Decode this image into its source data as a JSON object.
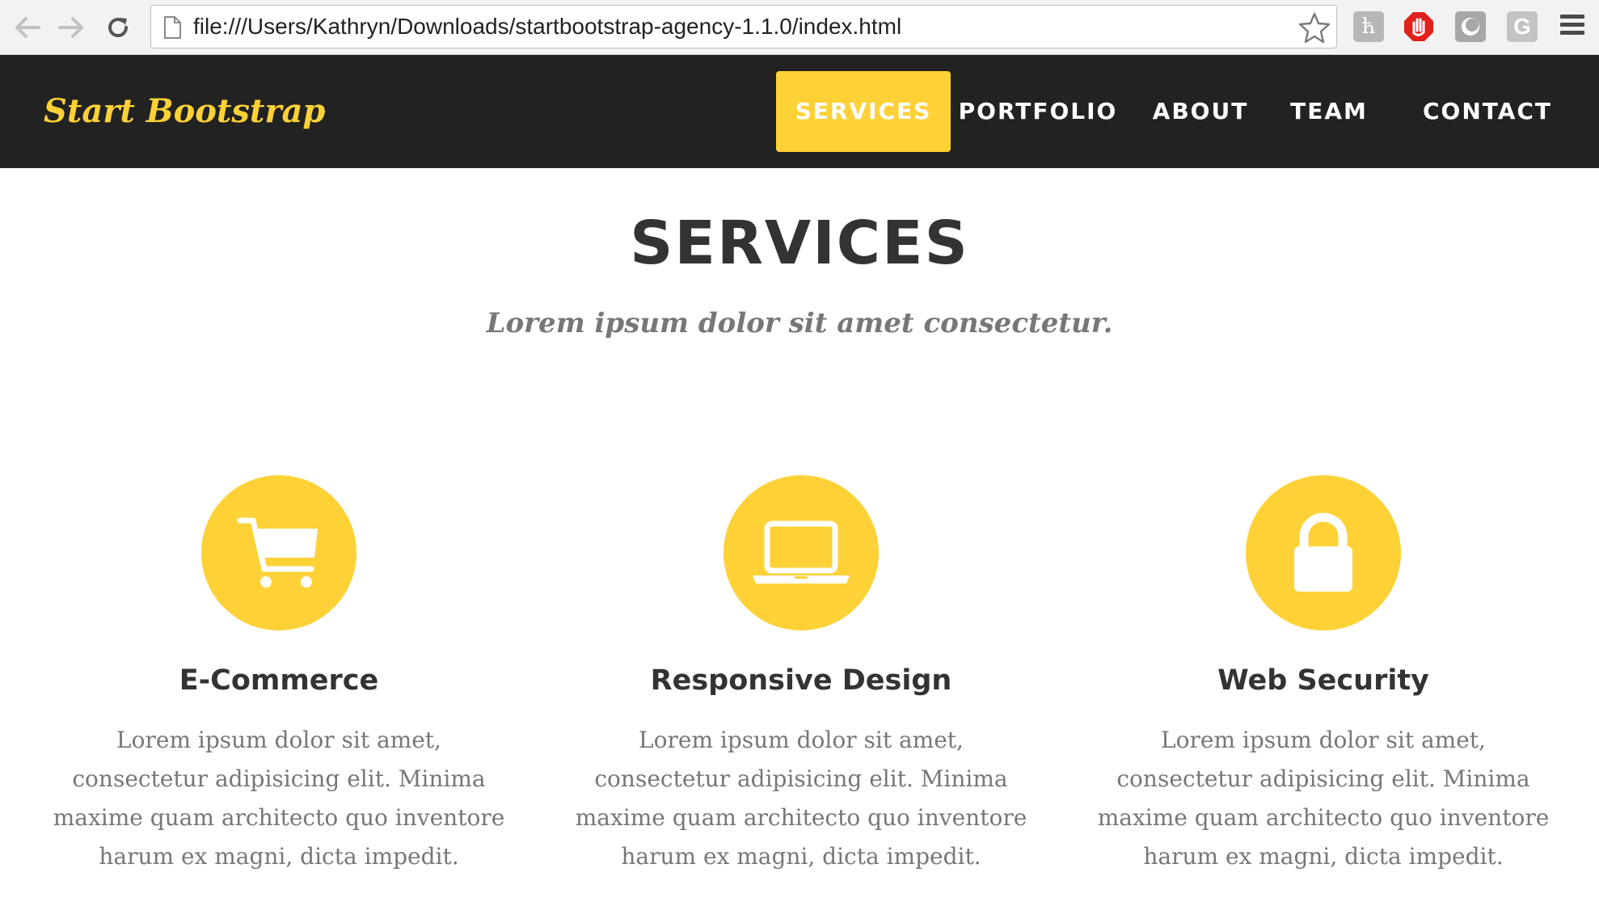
{
  "browser": {
    "url": "file:///Users/Kathryn/Downloads/startbootstrap-agency-1.1.0/index.html",
    "extensions": [
      "hootsuite-icon",
      "adblock-icon",
      "facebook-extension-icon",
      "grammarly-icon"
    ],
    "grammarly_letter": "G",
    "hootsuite_letter": "ћ"
  },
  "navbar": {
    "brand": "Start Bootstrap",
    "links": [
      {
        "label": "SERVICES",
        "active": true
      },
      {
        "label": "PORTFOLIO",
        "active": false
      },
      {
        "label": "ABOUT",
        "active": false
      },
      {
        "label": "TEAM",
        "active": false
      },
      {
        "label": "CONTACT",
        "active": false
      }
    ]
  },
  "services": {
    "heading": "SERVICES",
    "subheading": "Lorem ipsum dolor sit amet consectetur.",
    "items": [
      {
        "icon": "shopping-cart-icon",
        "title": "E-Commerce",
        "text": "Lorem ipsum dolor sit amet, consectetur adipisicing elit. Minima maxime quam architecto quo inventore harum ex magni, dicta impedit."
      },
      {
        "icon": "laptop-icon",
        "title": "Responsive Design",
        "text": "Lorem ipsum dolor sit amet, consectetur adipisicing elit. Minima maxime quam architecto quo inventore harum ex magni, dicta impedit."
      },
      {
        "icon": "lock-icon",
        "title": "Web Security",
        "text": "Lorem ipsum dolor sit amet, consectetur adipisicing elit. Minima maxime quam architecto quo inventore harum ex magni, dicta impedit."
      }
    ]
  },
  "colors": {
    "accent": "#fed136",
    "navbar_bg": "#222222",
    "heading": "#333333",
    "muted_text": "#777777"
  }
}
